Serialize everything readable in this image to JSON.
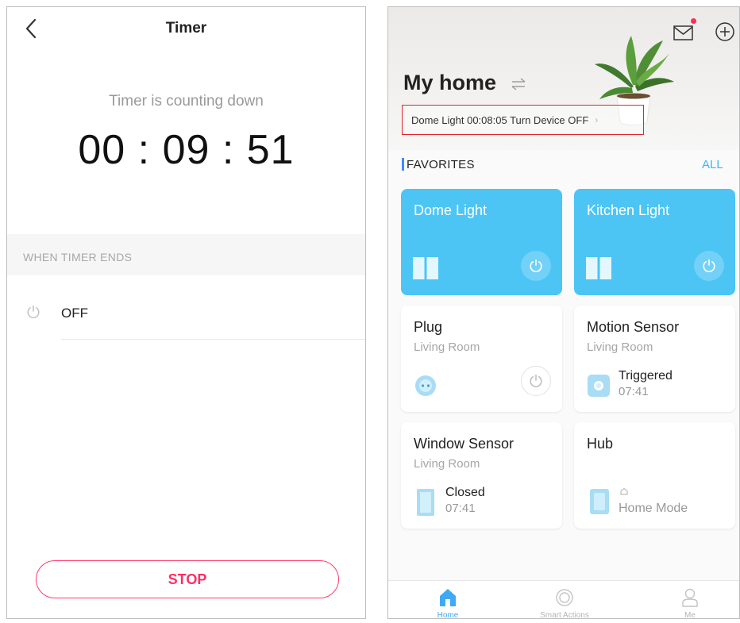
{
  "timer_screen": {
    "title": "Timer",
    "status_text": "Timer is counting down",
    "countdown": "00 : 09 : 51",
    "section_title": "WHEN TIMER ENDS",
    "action_label": "OFF",
    "stop_label": "STOP",
    "accent_color": "#ff2d62",
    "icons": {
      "back": "chevron-left-icon",
      "action": "power-icon"
    }
  },
  "home_screen": {
    "title": "My home",
    "notification": "Dome Light 00:08:05 Turn Device OFF",
    "favorites_title": "FAVORITES",
    "all_label": "ALL",
    "accent_color": "#4cc5f5",
    "devices": [
      {
        "name": "Dome Light",
        "state": "on",
        "icon": "light-switch-icon"
      },
      {
        "name": "Kitchen Light",
        "state": "on",
        "icon": "light-switch-icon"
      },
      {
        "name": "Plug",
        "room": "Living Room",
        "icon": "plug-icon"
      },
      {
        "name": "Motion Sensor",
        "room": "Living Room",
        "status": "Triggered",
        "time": "07:41",
        "icon": "motion-sensor-icon"
      },
      {
        "name": "Window Sensor",
        "room": "Living Room",
        "status": "Closed",
        "time": "07:41",
        "icon": "window-sensor-icon"
      },
      {
        "name": "Hub",
        "status": "Home Mode",
        "icon": "hub-icon"
      }
    ],
    "tabs": [
      {
        "label": "Home",
        "active": true,
        "icon": "home-icon"
      },
      {
        "label": "Smart Actions",
        "active": false,
        "icon": "smart-actions-icon"
      },
      {
        "label": "Me",
        "active": false,
        "icon": "person-icon"
      }
    ]
  }
}
